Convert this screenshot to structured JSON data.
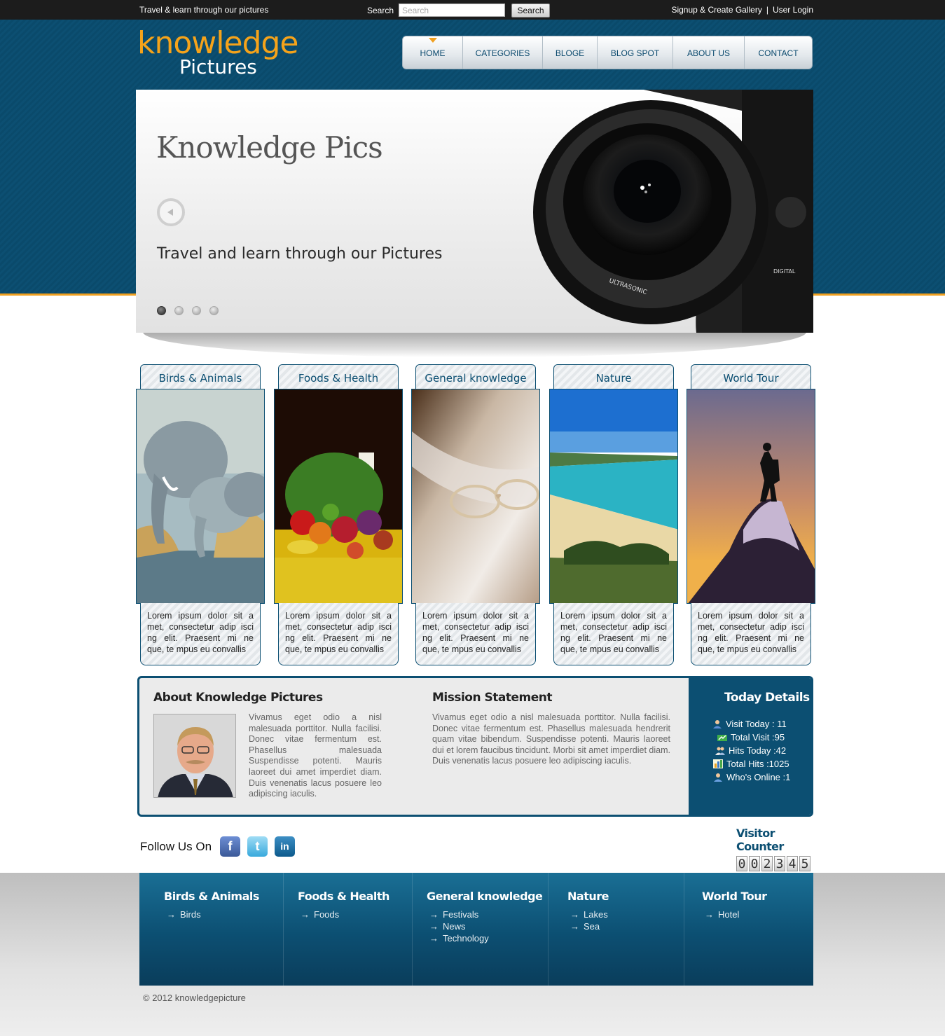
{
  "topbar": {
    "tagline": "Travel & learn through our pictures",
    "search_label": "Search",
    "search_placeholder": "Search",
    "search_button": "Search",
    "signup": "Signup & Create Gallery",
    "separator": "|",
    "login": "User Login"
  },
  "logo": {
    "line1": "knowledge",
    "line2": "Pictures"
  },
  "nav": {
    "items": [
      {
        "label": "HOME",
        "active": true
      },
      {
        "label": "CATEGORIES"
      },
      {
        "label": "BLOGE"
      },
      {
        "label": "BLOG SPOT"
      },
      {
        "label": "ABOUT US"
      },
      {
        "label": "CONTACT"
      }
    ]
  },
  "slider": {
    "title": "Knowledge Pics",
    "subtitle": "Travel and learn through our Pictures",
    "slide_count": 4,
    "active_slide": 1
  },
  "categories": [
    {
      "title": "Birds & Animals",
      "text": "Lorem ipsum dolor sit a met, consectetur adip isci ng elit. Praesent mi ne que, te mpus eu convallis"
    },
    {
      "title": "Foods & Health",
      "text": "Lorem ipsum dolor sit a met, consectetur adip isci ng elit. Praesent mi ne que, te mpus eu convallis"
    },
    {
      "title": "General knowledge",
      "text": "Lorem ipsum dolor sit a met, consectetur adip isci ng elit. Praesent mi ne que, te mpus eu convallis"
    },
    {
      "title": "Nature",
      "text": "Lorem ipsum dolor sit a met, consectetur adip isci ng elit. Praesent mi ne que, te mpus eu convallis"
    },
    {
      "title": "World Tour",
      "text": "Lorem ipsum dolor sit a met, consectetur adip isci ng elit. Praesent mi ne que, te mpus eu convallis"
    }
  ],
  "about": {
    "title": "About Knowledge Pictures",
    "text": "Vivamus eget odio a nisl malesuada porttitor. Nulla facilisi. Donec vitae fermentum est. Phasellus malesuada Suspendisse potenti. Mauris laoreet dui amet imperdiet diam. Duis venenatis lacus posuere leo adipiscing iaculis."
  },
  "mission": {
    "title": "Mission Statement",
    "text": "Vivamus eget odio a nisl malesuada porttitor. Nulla facilisi. Donec vitae fermentum est. Phasellus malesuada hendrerit quam vitae bibendum. Suspendisse potenti. Mauris laoreet dui et lorem faucibus tincidunt. Morbi sit amet imperdiet diam. Duis venenatis lacus posuere leo adipiscing iaculis."
  },
  "today": {
    "title": "Today Details",
    "items": [
      {
        "label": "Visit Today : 11",
        "icon": "user-icon"
      },
      {
        "label": "Total Visit :95",
        "icon": "chart-icon"
      },
      {
        "label": "Hits Today :42",
        "icon": "users-icon"
      },
      {
        "label": "Total Hits :1025",
        "icon": "bar-chart-icon"
      },
      {
        "label": "Who's Online :1",
        "icon": "online-user-icon"
      }
    ]
  },
  "follow": {
    "label": "Follow Us On"
  },
  "counter": {
    "title": "Visitor Counter",
    "digits": [
      "0",
      "0",
      "2",
      "3",
      "4",
      "5"
    ]
  },
  "footer": {
    "columns": [
      {
        "title": "Birds & Animals",
        "links": [
          "Birds"
        ]
      },
      {
        "title": "Foods & Health",
        "links": [
          "Foods"
        ]
      },
      {
        "title": "General knowledge",
        "links": [
          "Festivals",
          "News",
          "Technology"
        ]
      },
      {
        "title": "Nature",
        "links": [
          "Lakes",
          "Sea"
        ]
      },
      {
        "title": "World Tour",
        "links": [
          "Hotel"
        ]
      }
    ],
    "copyright": "© 2012 knowledgepicture"
  },
  "colors": {
    "brand_blue": "#0c4f72",
    "accent_orange": "#f0a020"
  }
}
